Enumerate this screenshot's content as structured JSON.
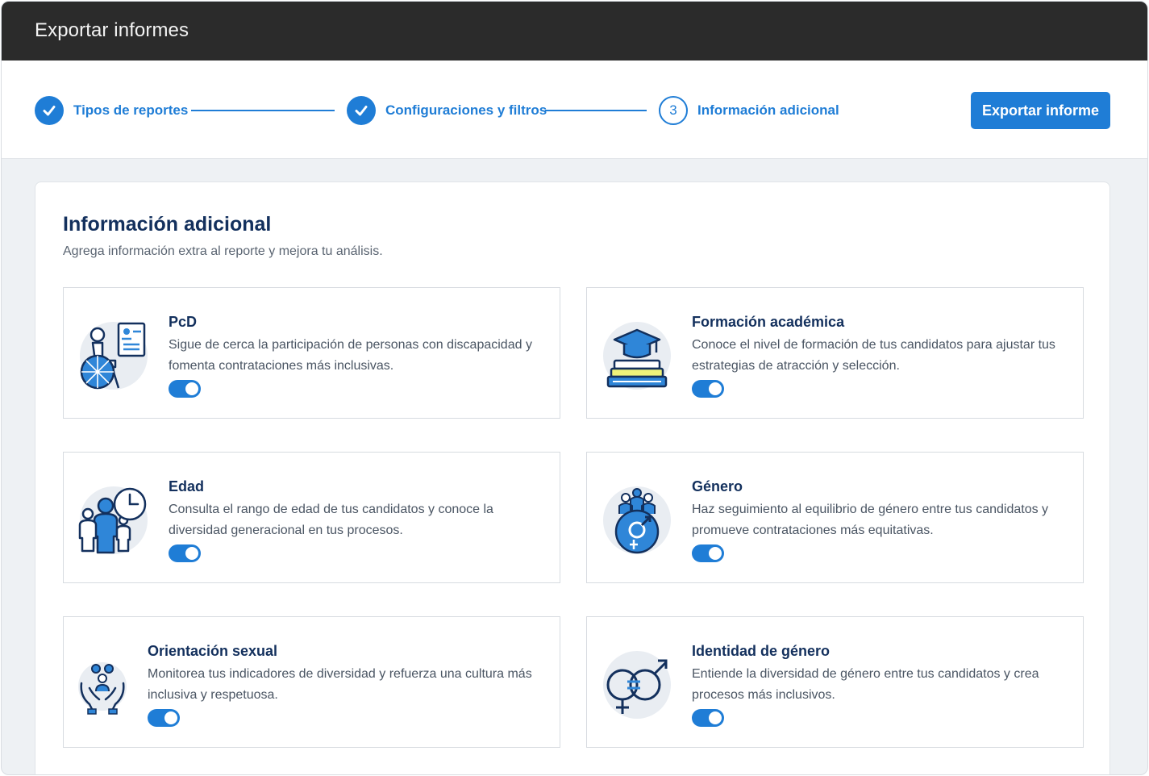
{
  "window": {
    "title": "Exportar informes"
  },
  "stepper": {
    "steps": [
      {
        "label": "Tipos de reportes",
        "state": "done"
      },
      {
        "label": "Configuraciones y filtros",
        "state": "done"
      },
      {
        "label": "Información adicional",
        "state": "current",
        "number": "3"
      }
    ]
  },
  "actions": {
    "export_label": "Exportar informe"
  },
  "section": {
    "title": "Información adicional",
    "subtitle": "Agrega información extra al reporte y mejora tu análisis."
  },
  "cards": [
    {
      "title": "PcD",
      "description": "Sigue de cerca la participación de personas con discapacidad y fomenta contrataciones más inclusivas.",
      "enabled": true,
      "icon": "wheelchair-icon"
    },
    {
      "title": "Formación académica",
      "description": "Conoce el nivel de formación de tus candidatos para ajustar tus estrategias de atracción y selección.",
      "enabled": true,
      "icon": "graduation-cap-icon"
    },
    {
      "title": "Edad",
      "description": "Consulta el rango de edad de tus candidatos y conoce la diversidad generacional en tus procesos.",
      "enabled": true,
      "icon": "age-group-icon"
    },
    {
      "title": "Género",
      "description": "Haz seguimiento al equilibrio de género entre tus candidatos y promueve contrataciones más equitativas.",
      "enabled": true,
      "icon": "gender-icon"
    },
    {
      "title": "Orientación sexual",
      "description": "Monitorea tus indicadores de diversidad y refuerza una cultura más inclusiva y respetuosa.",
      "enabled": true,
      "icon": "community-hands-icon"
    },
    {
      "title": "Identidad de género",
      "description": "Entiende la diversidad de género entre tus candidatos y crea procesos más inclusivos.",
      "enabled": true,
      "icon": "gender-identity-icon"
    }
  ],
  "colors": {
    "accent": "#1f7dd6",
    "title_dark": "#13305d",
    "titlebar": "#2b2b2b"
  }
}
